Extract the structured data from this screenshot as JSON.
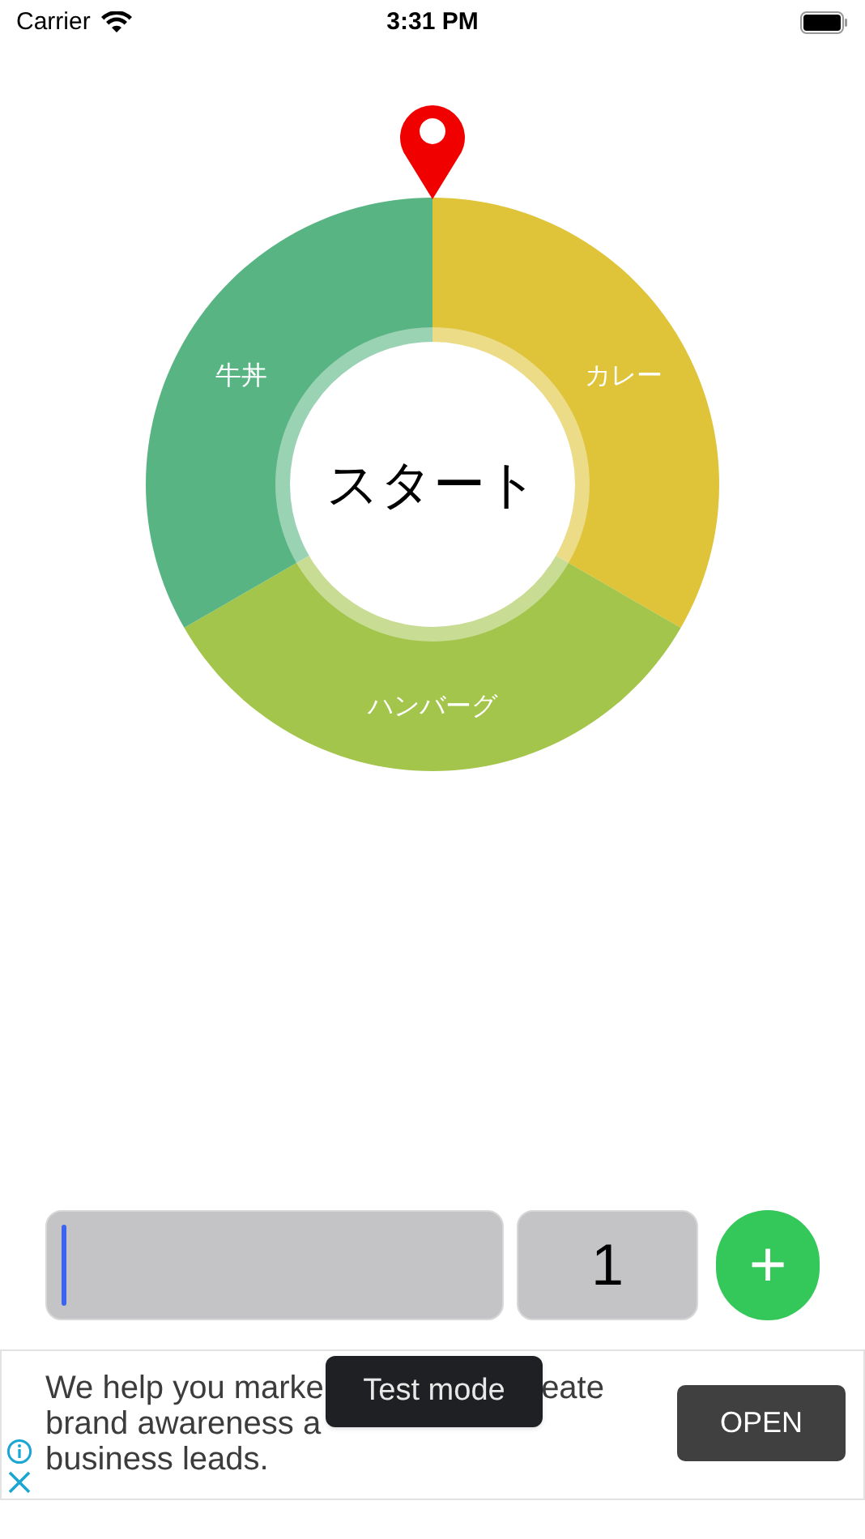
{
  "status_bar": {
    "carrier": "Carrier",
    "time": "3:31 PM"
  },
  "wheel": {
    "center_label": "スタート",
    "items": [
      {
        "name": "カレー",
        "color": "#dfc338"
      },
      {
        "name": "ハンバーグ",
        "color": "#a3c54b"
      },
      {
        "name": "牛丼",
        "color": "#58b482"
      }
    ]
  },
  "entry": {
    "weight_value": "1",
    "add_label": "+"
  },
  "ad": {
    "line_1_left": "We help you marke",
    "line_1_right": "eate",
    "line_2": "brand awareness a",
    "line_3": "business leads.",
    "open_label": "OPEN",
    "toast": "Test mode"
  }
}
